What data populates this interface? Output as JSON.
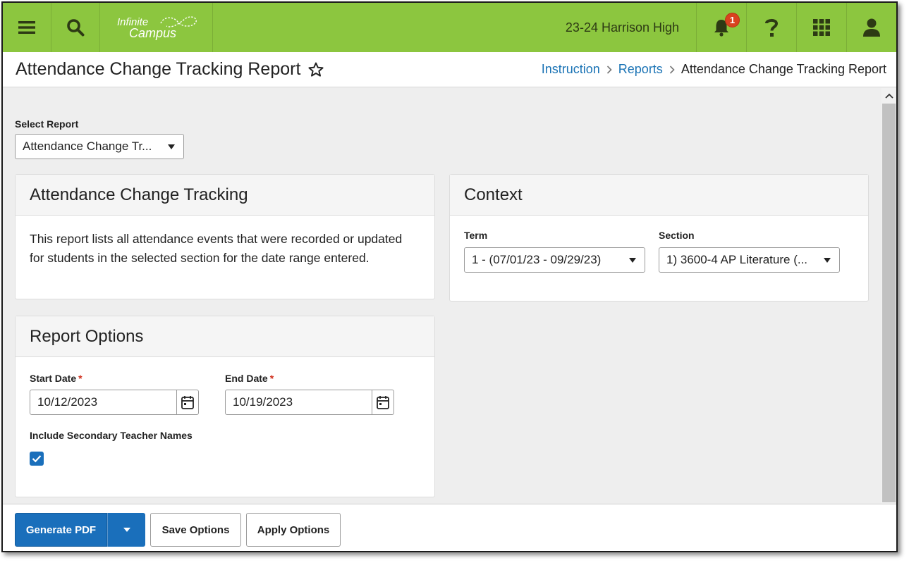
{
  "header": {
    "logo_text": "Infinite Campus",
    "school": "23-24 Harrison High",
    "notification_count": "1",
    "icons": [
      "menu-icon",
      "search-icon",
      "bell-icon",
      "help-icon",
      "apps-grid-icon",
      "user-icon"
    ],
    "brand_color": "#8cc63f"
  },
  "page": {
    "title": "Attendance Change Tracking Report",
    "breadcrumb": [
      "Instruction",
      "Reports",
      "Attendance Change Tracking Report"
    ]
  },
  "select_report": {
    "label": "Select Report",
    "value": "Attendance Change Tr..."
  },
  "info_card": {
    "title": "Attendance Change Tracking",
    "description": "This report lists all attendance events that were recorded or updated for students in the selected section for the date range entered."
  },
  "context_card": {
    "title": "Context",
    "term_label": "Term",
    "term_value": "1 - (07/01/23 - 09/29/23)",
    "section_label": "Section",
    "section_value": "1) 3600-4 AP Literature (..."
  },
  "options_card": {
    "title": "Report Options",
    "start_label": "Start Date",
    "start_value": "10/12/2023",
    "end_label": "End Date",
    "end_value": "10/19/2023",
    "required_mark": "*",
    "secondary_label": "Include Secondary Teacher Names",
    "secondary_checked": true
  },
  "footer": {
    "generate_label": "Generate PDF",
    "save_label": "Save Options",
    "apply_label": "Apply Options"
  },
  "colors": {
    "primary": "#1a6fbb",
    "link": "#1a73b5",
    "required": "#d0301e"
  }
}
